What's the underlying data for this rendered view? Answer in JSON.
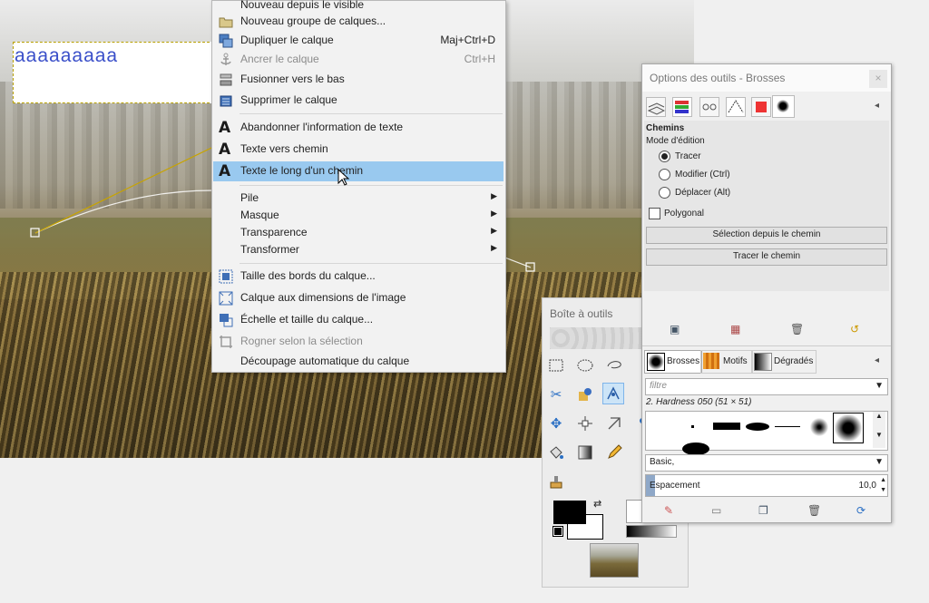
{
  "canvas": {
    "text_layer_value": "aaaaaaaaa"
  },
  "menu": {
    "items": [
      {
        "label": "Nouveau depuis le visible",
        "shortcut": "",
        "icon": "none",
        "disabled": false
      },
      {
        "label": "Nouveau groupe de calques...",
        "shortcut": "",
        "icon": "folder-icon",
        "disabled": false
      },
      {
        "label": "Dupliquer le calque",
        "shortcut": "Maj+Ctrl+D",
        "icon": "duplicate-layer-icon",
        "disabled": false
      },
      {
        "label": "Ancrer le calque",
        "shortcut": "Ctrl+H",
        "icon": "anchor-icon",
        "disabled": true
      },
      {
        "label": "Fusionner vers le bas",
        "shortcut": "",
        "icon": "merge-down-icon",
        "disabled": false
      },
      {
        "label": "Supprimer le calque",
        "shortcut": "",
        "icon": "delete-layer-icon",
        "disabled": false
      },
      {
        "label": "Abandonner l'information de texte",
        "shortcut": "",
        "icon": "text-A-icon",
        "disabled": false
      },
      {
        "label": "Texte vers chemin",
        "shortcut": "",
        "icon": "text-A-icon",
        "disabled": false
      },
      {
        "label": "Texte le long d'un chemin",
        "shortcut": "",
        "icon": "text-A-icon",
        "disabled": false,
        "highlighted": true
      },
      {
        "label": "Pile",
        "submenu": true
      },
      {
        "label": "Masque",
        "submenu": true
      },
      {
        "label": "Transparence",
        "submenu": true
      },
      {
        "label": "Transformer",
        "submenu": true
      },
      {
        "label": "Taille des bords du calque...",
        "shortcut": "",
        "icon": "layer-boundary-icon",
        "disabled": false
      },
      {
        "label": "Calque aux dimensions de l'image",
        "shortcut": "",
        "icon": "layer-to-image-size-icon",
        "disabled": false
      },
      {
        "label": "Échelle et taille du calque...",
        "shortcut": "",
        "icon": "scale-layer-icon",
        "disabled": false
      },
      {
        "label": "Rogner selon la sélection",
        "shortcut": "",
        "icon": "crop-icon",
        "disabled": true
      },
      {
        "label": "Découpage automatique du calque",
        "shortcut": "",
        "icon": "none",
        "disabled": false
      }
    ]
  },
  "toolbox": {
    "title": "Boîte à outils"
  },
  "tool_options": {
    "title": "Options des outils - Brosses",
    "close": "×",
    "section_title": "Chemins",
    "mode_label": "Mode d'édition",
    "modes": [
      "Tracer",
      "Modifier (Ctrl)",
      "Déplacer (Alt)"
    ],
    "selected_mode": "Tracer",
    "polygonal_label": "Polygonal",
    "btn_selection": "Sélection depuis le chemin",
    "btn_stroke": "Tracer le chemin",
    "tabs": [
      "Brosses",
      "Motifs",
      "Dégradés"
    ],
    "filter_placeholder": "filtre",
    "brush_name": "2. Hardness 050 (51 × 51)",
    "tag_value": "Basic,",
    "spacing_label": "Espacement",
    "spacing_value": "10,0"
  },
  "colors": {
    "highlight": "#99c9ef",
    "text_layer": "#3a4fc9"
  }
}
